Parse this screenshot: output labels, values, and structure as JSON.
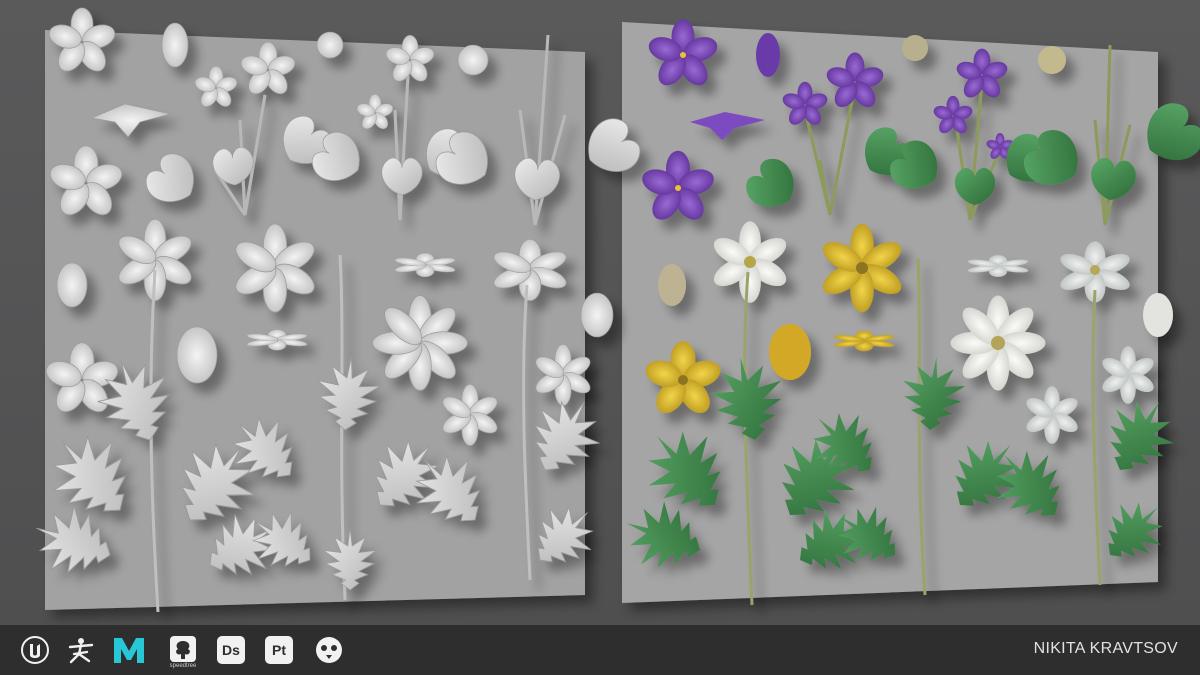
{
  "footer": {
    "tools": [
      {
        "icon": "unreal-engine-icon",
        "label": ""
      },
      {
        "icon": "zbrush-icon",
        "label": ""
      },
      {
        "icon": "maya-icon",
        "label": ""
      },
      {
        "icon": "speedtree-icon",
        "label": "speedtree"
      },
      {
        "icon": "substance-designer-icon",
        "label": "Ds"
      },
      {
        "icon": "substance-painter-icon",
        "label": "Pt"
      },
      {
        "icon": "marmoset-toolbag-icon",
        "label": ""
      }
    ],
    "author": "NIKITA KRAVTSOV"
  },
  "colors": {
    "background": "#555556",
    "board": "#a2a2a2",
    "clay": "#cfcfcf",
    "violet": "#7a4bb5",
    "white_petal": "#e8e8e4",
    "yellow_petal": "#d9b92c",
    "leaf": "#3f8a4a",
    "footer": "#2e2e2f",
    "maya_cyan": "#27c7d8"
  }
}
